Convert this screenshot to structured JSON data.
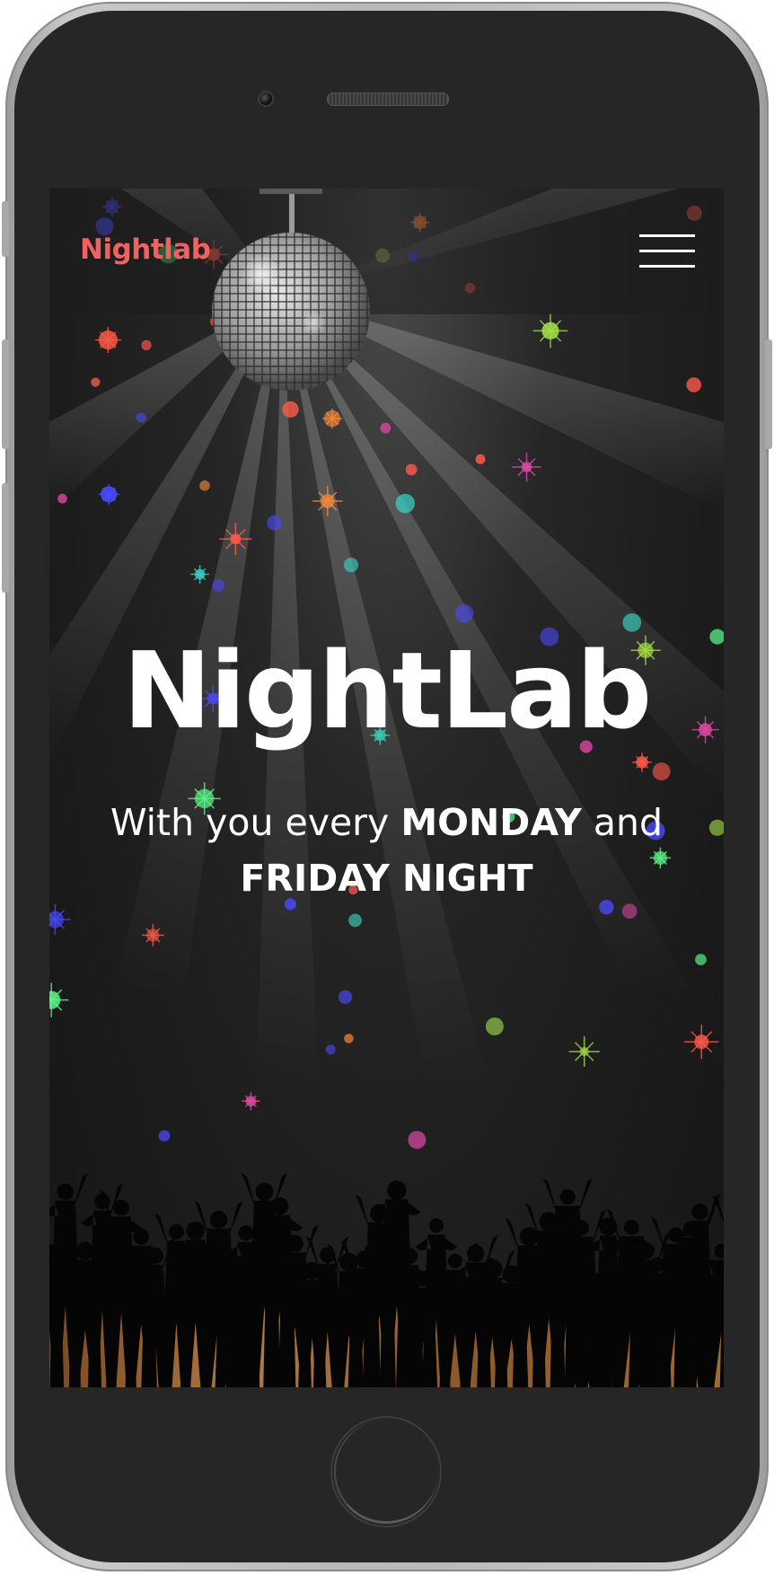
{
  "header": {
    "brand": "Nightlab",
    "menu_icon": "hamburger-menu-icon"
  },
  "hero": {
    "title": "NightLab",
    "subtitle_part1": "With you every ",
    "subtitle_bold1": "MONDAY",
    "subtitle_part2": " and ",
    "subtitle_bold2": "FRIDAY NIGHT"
  },
  "colors": {
    "brand": "#f0615f",
    "text": "#ffffff",
    "background": "#1c1c1c",
    "floor": "#8a5a2b"
  },
  "icons": {
    "disco_ball": "disco-ball-icon",
    "crowd": "dancing-crowd-silhouette",
    "camera": "camera-icon",
    "speaker": "speaker-grille-icon",
    "home_button": "home-button-icon"
  }
}
